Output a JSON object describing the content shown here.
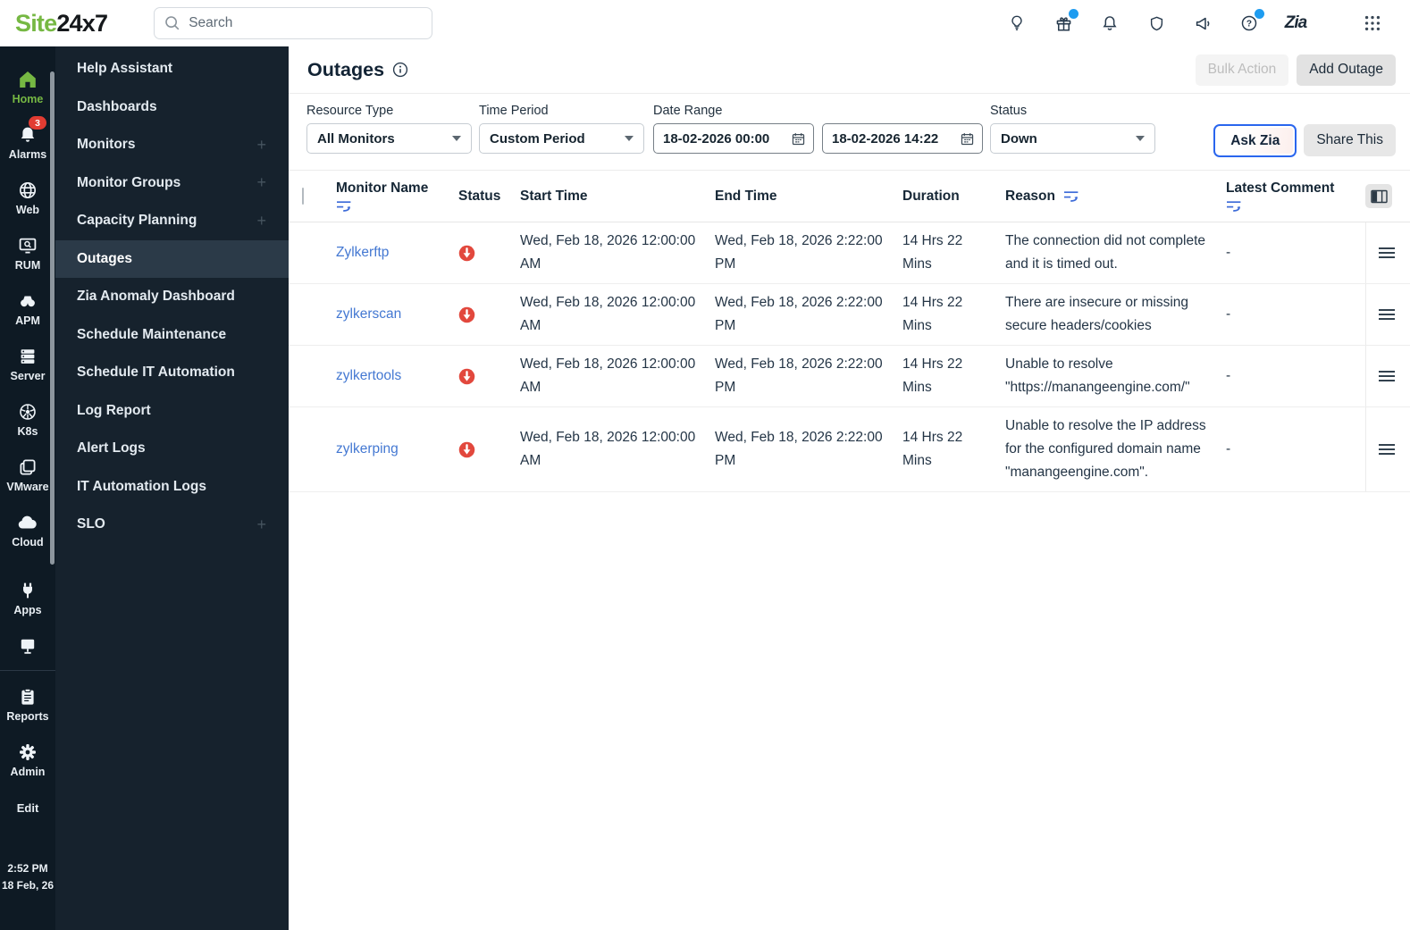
{
  "brand": {
    "name_green": "Site",
    "name_dark": "24x7"
  },
  "topbar": {
    "search_placeholder": "Search",
    "icons": {
      "idea": "lightbulb-icon",
      "whats_new": "gift-icon (blue dot)",
      "notifications": "bell-icon",
      "security": "shield-icon",
      "announcements": "megaphone-icon",
      "help": "help-icon (blue dot)",
      "zia": "Zia",
      "apps_grid": "grid-icon"
    }
  },
  "rail": {
    "items": [
      {
        "name": "home",
        "label": "Home",
        "active": true
      },
      {
        "name": "alarms",
        "label": "Alarms",
        "badge": "3"
      },
      {
        "name": "web",
        "label": "Web"
      },
      {
        "name": "rum",
        "label": "RUM"
      },
      {
        "name": "apm",
        "label": "APM"
      },
      {
        "name": "server",
        "label": "Server"
      },
      {
        "name": "k8s",
        "label": "K8s"
      },
      {
        "name": "vmware",
        "label": "VMware"
      },
      {
        "name": "cloud",
        "label": "Cloud"
      },
      {
        "name": "apps",
        "label": "Apps"
      },
      {
        "name": "network",
        "label": ""
      },
      {
        "name": "reports",
        "label": "Reports"
      },
      {
        "name": "admin",
        "label": "Admin"
      }
    ],
    "edit_label": "Edit",
    "clock": {
      "time": "2:52 PM",
      "date": "18 Feb, 26"
    }
  },
  "nav": {
    "items": [
      {
        "label": "Help Assistant"
      },
      {
        "label": "Dashboards"
      },
      {
        "label": "Monitors",
        "expandable": true
      },
      {
        "label": "Monitor Groups",
        "expandable": true
      },
      {
        "label": "Capacity Planning",
        "expandable": true
      },
      {
        "label": "Outages",
        "active": true
      },
      {
        "label": "Zia Anomaly Dashboard"
      },
      {
        "label": "Schedule Maintenance"
      },
      {
        "label": "Schedule IT Automation"
      },
      {
        "label": "Log Report"
      },
      {
        "label": "Alert Logs"
      },
      {
        "label": "IT Automation Logs"
      },
      {
        "label": "SLO",
        "expandable": true
      }
    ]
  },
  "page": {
    "title": "Outages",
    "bulk_action_label": "Bulk Action",
    "add_outage_label": "Add Outage"
  },
  "filters": {
    "resource_type": {
      "label": "Resource Type",
      "value": "All Monitors"
    },
    "time_period": {
      "label": "Time Period",
      "value": "Custom Period"
    },
    "date_range": {
      "label": "Date Range",
      "from": "18-02-2026 00:00",
      "to": "18-02-2026 14:22"
    },
    "status": {
      "label": "Status",
      "value": "Down"
    },
    "ask_zia_label": "Ask Zia",
    "share_this_label": "Share This"
  },
  "table": {
    "headers": {
      "monitor": "Monitor Name",
      "status": "Status",
      "start": "Start Time",
      "end": "End Time",
      "duration": "Duration",
      "reason": "Reason",
      "comment": "Latest Comment"
    },
    "rows": [
      {
        "monitor": "Zylkerftp",
        "status": "Down",
        "start": "Wed, Feb 18, 2026 12:00:00 AM",
        "end": "Wed, Feb 18, 2026 2:22:00 PM",
        "duration": "14 Hrs 22 Mins",
        "reason": "The connection did not complete and it is timed out.",
        "comment": "-"
      },
      {
        "monitor": "zylkerscan",
        "status": "Down",
        "start": "Wed, Feb 18, 2026 12:00:00 AM",
        "end": "Wed, Feb 18, 2026 2:22:00 PM",
        "duration": "14 Hrs 22 Mins",
        "reason": "There are insecure or missing secure headers/cookies",
        "comment": "-"
      },
      {
        "monitor": "zylkertools",
        "status": "Down",
        "start": "Wed, Feb 18, 2026 12:00:00 AM",
        "end": "Wed, Feb 18, 2026 2:22:00 PM",
        "duration": "14 Hrs 22 Mins",
        "reason": "Unable to resolve \"https://manangeengine.com/\"",
        "comment": "-"
      },
      {
        "monitor": "zylkerping",
        "status": "Down",
        "start": "Wed, Feb 18, 2026 12:00:00 AM",
        "end": "Wed, Feb 18, 2026 2:22:00 PM",
        "duration": "14 Hrs 22 Mins",
        "reason": "Unable to resolve the IP address for the configured domain name \"manangeengine.com\".",
        "comment": "-"
      }
    ]
  },
  "colors": {
    "brand_green": "#76b843",
    "sidebar_dark": "#0e1a24",
    "menu_dark": "#16222d",
    "active_item": "#2b3a48",
    "status_down_red": "#e2483d",
    "link_blue": "#4478d2",
    "filter_icon_blue": "#3d6bd8",
    "badge_blue": "#1e9cf0",
    "badge_red": "#e23c32",
    "ask_zia_border": "#2a66ee"
  }
}
